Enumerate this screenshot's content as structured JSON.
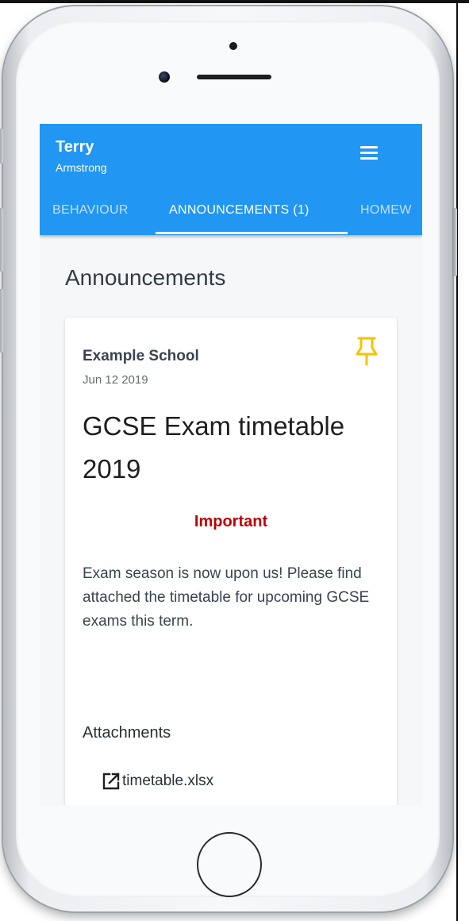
{
  "header": {
    "first_name": "Terry",
    "last_name": "Armstrong",
    "menu_icon": "hamburger-menu-icon",
    "bar_color": "#2196f3"
  },
  "tabs": [
    {
      "label": "BEHAVIOUR",
      "active": false
    },
    {
      "label": "ANNOUNCEMENTS (1)",
      "active": true
    },
    {
      "label": "HOMEW",
      "active": false
    }
  ],
  "main": {
    "page_title": "Announcements",
    "announcement": {
      "school": "Example School",
      "date": "Jun 12 2019",
      "title": "GCSE Exam timetable 2019",
      "priority": "Important",
      "priority_color": "#c00000",
      "body": "Exam season is now upon us! Please find attached the timetable for upcoming GCSE exams this term.",
      "pinned": true,
      "pin_icon": "pin-icon",
      "pin_color": "#f5c400",
      "attachments_heading": "Attachments",
      "attachments": [
        {
          "name": "timetable.xlsx",
          "icon": "external-link-icon"
        }
      ]
    }
  }
}
